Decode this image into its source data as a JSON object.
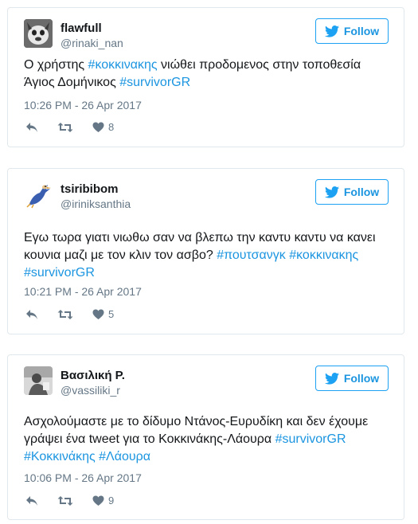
{
  "follow_label": "Follow",
  "tweets": [
    {
      "name": "flawfull",
      "handle": "@rinaki_nan",
      "text_plain": "Ο χρήστης ",
      "tag1": "#κοκκινακης",
      "text_mid": " νιώθει προδομενος στην τοποθεσία Άγιος Δομήνικος ",
      "tag2": "#survivorGR",
      "time": "10:26 PM - 26 Apr 2017",
      "likes": "8"
    },
    {
      "name": "tsiribibom",
      "handle": "@iriniksanthia",
      "text_plain": "Εγω τωρα γιατι νιωθω σαν να βλεπω την καντυ καντυ να κανει κουνια μαζι με τον κλιν τον ασβο? ",
      "tag1": "#πουτσανγκ",
      "tag2": "#κοκκινακης",
      "tag3": "#survivorGR",
      "time": "10:21 PM - 26 Apr 2017",
      "likes": "5"
    },
    {
      "name": "Βασιλική Ρ.",
      "handle": "@vassiliki_r",
      "text_plain": "Ασχολούμαστε με το δίδυμο Ντάνος-Ευρυδίκη και δεν έχουμε γράψει ένα tweet για το Κοκκινάκης-Λάουρα ",
      "tag1": "#survivorGR",
      "tag2": "#Κοκκινάκης",
      "tag3": "#Λάουρα",
      "time": "10:06 PM - 26 Apr 2017",
      "likes": "9"
    }
  ]
}
